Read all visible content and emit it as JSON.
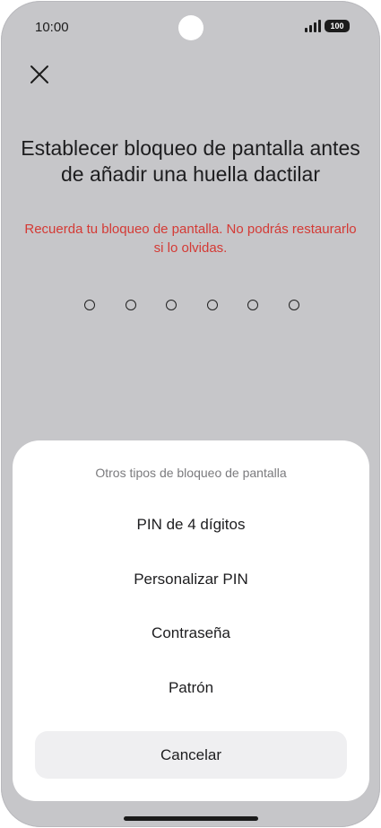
{
  "status_bar": {
    "time": "10:00",
    "battery_level": "100",
    "signal_icon": "signal-icon"
  },
  "header": {
    "close_icon": "close-icon"
  },
  "main": {
    "title": "Establecer bloqueo de pantalla antes de añadir una huella dactilar",
    "warning": "Recuerda tu bloqueo de pantalla. No podrás restaurarlo si lo olvidas.",
    "pin_length": 6,
    "warning_color": "#d43a35"
  },
  "sheet": {
    "title": "Otros tipos de bloqueo de pantalla",
    "options": [
      {
        "label": "PIN de 4 dígitos"
      },
      {
        "label": "Personalizar PIN"
      },
      {
        "label": "Contraseña"
      },
      {
        "label": "Patrón"
      }
    ],
    "cancel_label": "Cancelar"
  }
}
